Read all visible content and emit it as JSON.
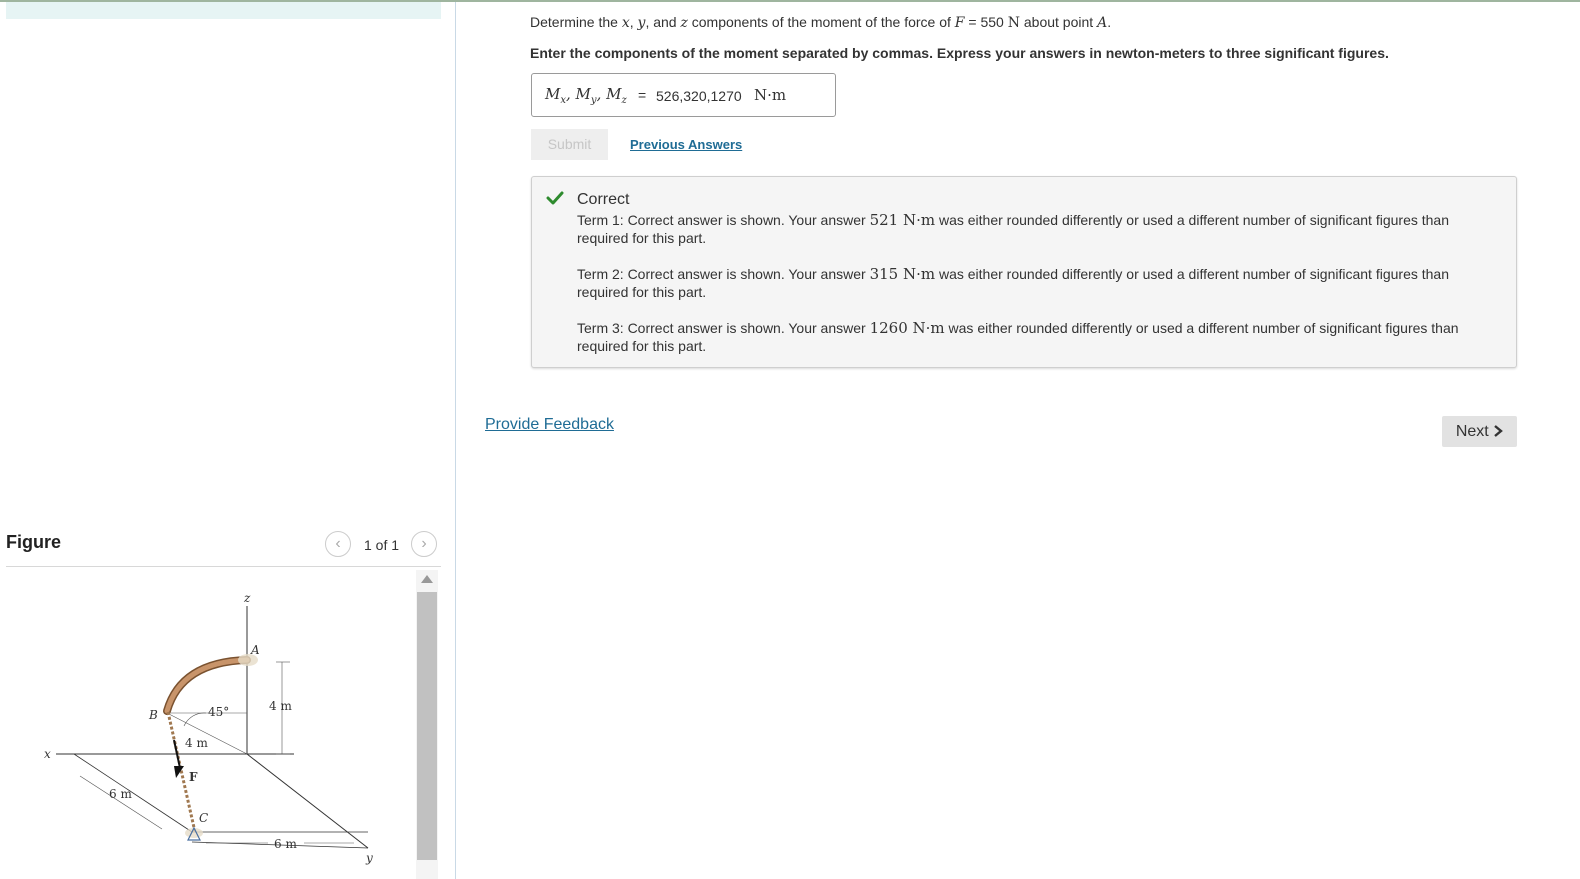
{
  "question": {
    "prefix": "Determine the",
    "var_x": "x",
    "sep1": ",",
    "var_y": "y",
    "sep2": ", and",
    "var_z": "z",
    "middle": "components of the moment of the force of",
    "force_symbol": "F",
    "equals": "=",
    "force_value": "550",
    "force_unit": "N",
    "about_text": "about point",
    "point": "A",
    "end": "."
  },
  "instruction": "Enter the components of the moment separated by commas. Express your answers in newton-meters to three significant figures.",
  "answer": {
    "label": "Mₓ, M_y, M_z",
    "equals": "=",
    "value": "526,320,1270",
    "unit": "N·m"
  },
  "buttons": {
    "submit": "Submit",
    "previous_answers": "Previous Answers",
    "provide_feedback": "Provide Feedback",
    "next": "Next"
  },
  "feedback": {
    "title": "Correct",
    "terms": [
      {
        "lead": "Term 1: Correct answer is shown. Your answer",
        "value": "521 N·m",
        "tail": "was either rounded differently or used a different number of significant figures than required for this part."
      },
      {
        "lead": "Term 2: Correct answer is shown. Your answer",
        "value": "315 N·m",
        "tail": "was either rounded differently or used a different number of significant figures than required for this part."
      },
      {
        "lead": "Term 3: Correct answer is shown. Your answer",
        "value": "1260 N·m",
        "tail": "was either rounded differently or used a different number of significant figures than required for this part."
      }
    ]
  },
  "figure": {
    "title": "Figure",
    "counter": "1 of 1",
    "labels": {
      "z": "z",
      "x": "x",
      "y": "y",
      "A": "A",
      "B": "B",
      "C": "C",
      "F": "F",
      "angle": "45°",
      "dim_4m_a": "4 m",
      "dim_4m_b": "4 m",
      "dim_6m_a": "6 m",
      "dim_6m_b": "6 m"
    }
  },
  "colors": {
    "link": "#1f6c95",
    "check": "#2e8b2e",
    "pipe": "#c8946a",
    "rope": "#c8a880"
  }
}
